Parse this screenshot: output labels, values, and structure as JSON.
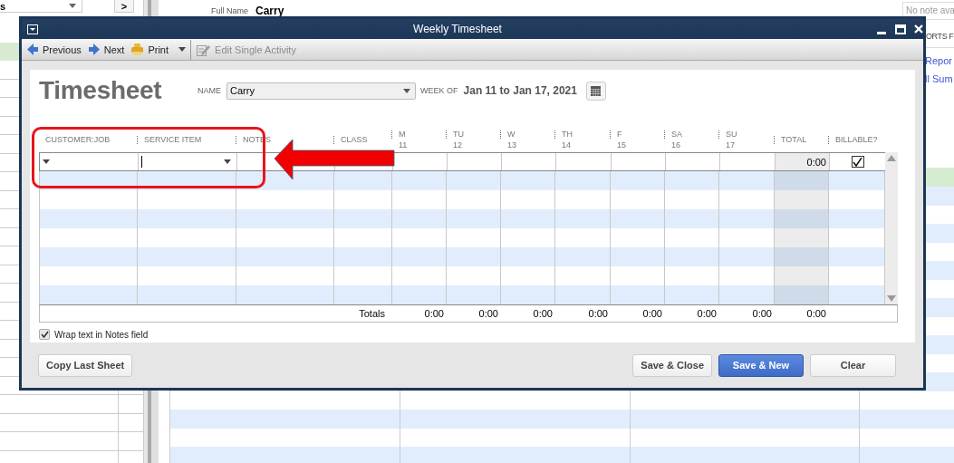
{
  "background_app": {
    "dropdown_value": "s",
    "next_button": ">",
    "full_name_label": "Full Name",
    "full_name": "Carry",
    "note_field": "No note ava",
    "side_heading": "ORTS F",
    "side_links": [
      "Repor",
      "ll Sum"
    ]
  },
  "window": {
    "title": "Weekly Timesheet"
  },
  "toolbar": [
    {
      "kind": "back",
      "label": "Previous",
      "disabled": false
    },
    {
      "kind": "forward",
      "label": "Next",
      "disabled": false
    },
    {
      "kind": "print",
      "label": "Print",
      "disabled": false
    },
    {
      "kind": "dropdown"
    },
    {
      "kind": "edit",
      "label": "Edit Single Activity",
      "disabled": true
    }
  ],
  "form": {
    "title": "Timesheet",
    "name_label": "NAME",
    "name_value": "Carry",
    "week_label": "WEEK OF",
    "week_value": "Jan 11 to Jan 17, 2021"
  },
  "columns": [
    {
      "label": "CUSTOMER:JOB"
    },
    {
      "label": "SERVICE ITEM"
    },
    {
      "label": "NOTES"
    },
    {
      "label": "CLASS"
    },
    {
      "label": "M",
      "day": "11"
    },
    {
      "label": "TU",
      "day": "12"
    },
    {
      "label": "W",
      "day": "13"
    },
    {
      "label": "TH",
      "day": "14"
    },
    {
      "label": "F",
      "day": "15"
    },
    {
      "label": "SA",
      "day": "16"
    },
    {
      "label": "SU",
      "day": "17"
    },
    {
      "label": "TOTAL"
    },
    {
      "label": "BILLABLE?"
    }
  ],
  "entry_row": {
    "service_item_focused": true,
    "total": "0:00",
    "billable": true
  },
  "totals": {
    "label": "Totals",
    "values": [
      "0:00",
      "0:00",
      "0:00",
      "0:00",
      "0:00",
      "0:00",
      "0:00",
      "0:00"
    ]
  },
  "wrap_notes": {
    "label": "Wrap text in Notes field",
    "checked": true
  },
  "left_buttons": [
    {
      "label": "Copy Last Sheet",
      "primary": false
    }
  ],
  "right_buttons": [
    {
      "label": "Save & Close",
      "primary": false
    },
    {
      "label": "Save & New",
      "primary": true
    },
    {
      "label": "Clear",
      "primary": false
    }
  ]
}
